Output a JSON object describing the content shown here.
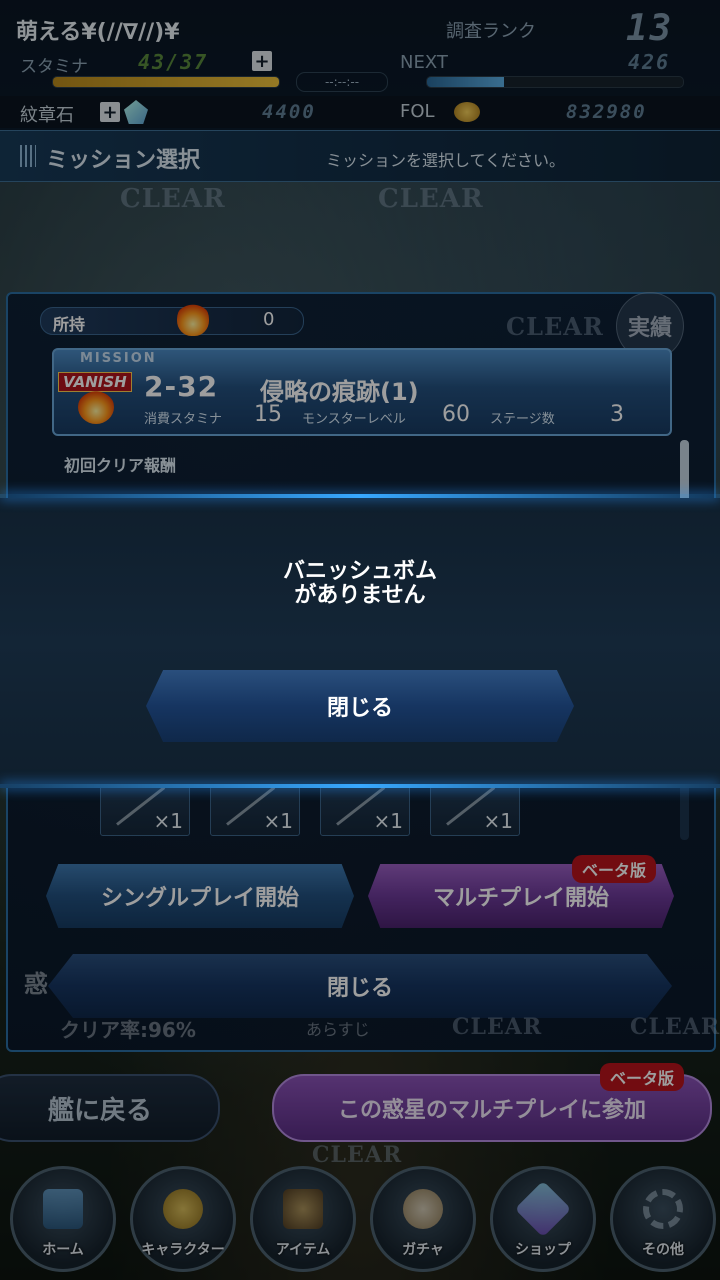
{
  "header": {
    "player_name": "萌える¥(//∇//)¥",
    "rank_label": "調査ランク",
    "rank_value": "13",
    "stamina_label": "スタミナ",
    "stamina_value": "43/37",
    "stamina_fill": 1.0,
    "timer": "--:--:--",
    "next_label": "NEXT",
    "next_value": "426",
    "next_fill": 0.3,
    "emblem_label": "紋章石",
    "emblem_value": "4400",
    "fol_label": "FOL",
    "fol_value": "832980"
  },
  "section": {
    "title": "ミッション選択",
    "instruction": "ミッションを選択してください。"
  },
  "background": {
    "clear_labels": [
      "CLEAR",
      "CLEAR",
      "CLEAR",
      "CLEAR",
      "CLEAR",
      "CLEAR"
    ],
    "achievement_label": "実績",
    "behind_planet_label": "惑",
    "clear_rate": "クリア率:96%",
    "behind_text": "あらすじ"
  },
  "panel": {
    "own_label": "所持",
    "own_value": "0",
    "mission": {
      "label": "MISSION",
      "vanish": "VANISH",
      "number": "2-32",
      "title": "侵略の痕跡(1)",
      "stamina_label": "消費スタミナ",
      "stamina_value": "15",
      "monster_level_label": "モンスターレベル",
      "monster_level_value": "60",
      "stages_label": "ステージ数",
      "stages_value": "3"
    },
    "first_clear_label": "初回クリア報酬",
    "reward_items": [
      {
        "qty": "×1"
      },
      {
        "qty": "×1"
      },
      {
        "qty": "×1"
      },
      {
        "qty": "×1"
      }
    ],
    "single_play": "シングルプレイ開始",
    "multi_play": "マルチプレイ開始",
    "beta_label": "ベータ版",
    "close": "閉じる"
  },
  "footer": {
    "back_to_ship": "艦に戻る",
    "join_multi": "この惑星のマルチプレイに参加",
    "beta_label": "ベータ版"
  },
  "nav": {
    "items": [
      {
        "label": "ホーム",
        "icon": "home-icon"
      },
      {
        "label": "キャラクター",
        "icon": "character-icon"
      },
      {
        "label": "アイテム",
        "icon": "item-icon"
      },
      {
        "label": "ガチャ",
        "icon": "gacha-icon"
      },
      {
        "label": "ショップ",
        "icon": "shop-icon"
      },
      {
        "label": "その他",
        "icon": "settings-gear-icon"
      }
    ]
  },
  "modal": {
    "message_line1": "バニッシュボム",
    "message_line2": "がありません",
    "close": "閉じる"
  },
  "colors": {
    "accent_blue": "#38a8ff",
    "stamina_bar": "#e8b62a",
    "beta_red": "#b8141c",
    "multi_purple": "#6d3a99"
  }
}
